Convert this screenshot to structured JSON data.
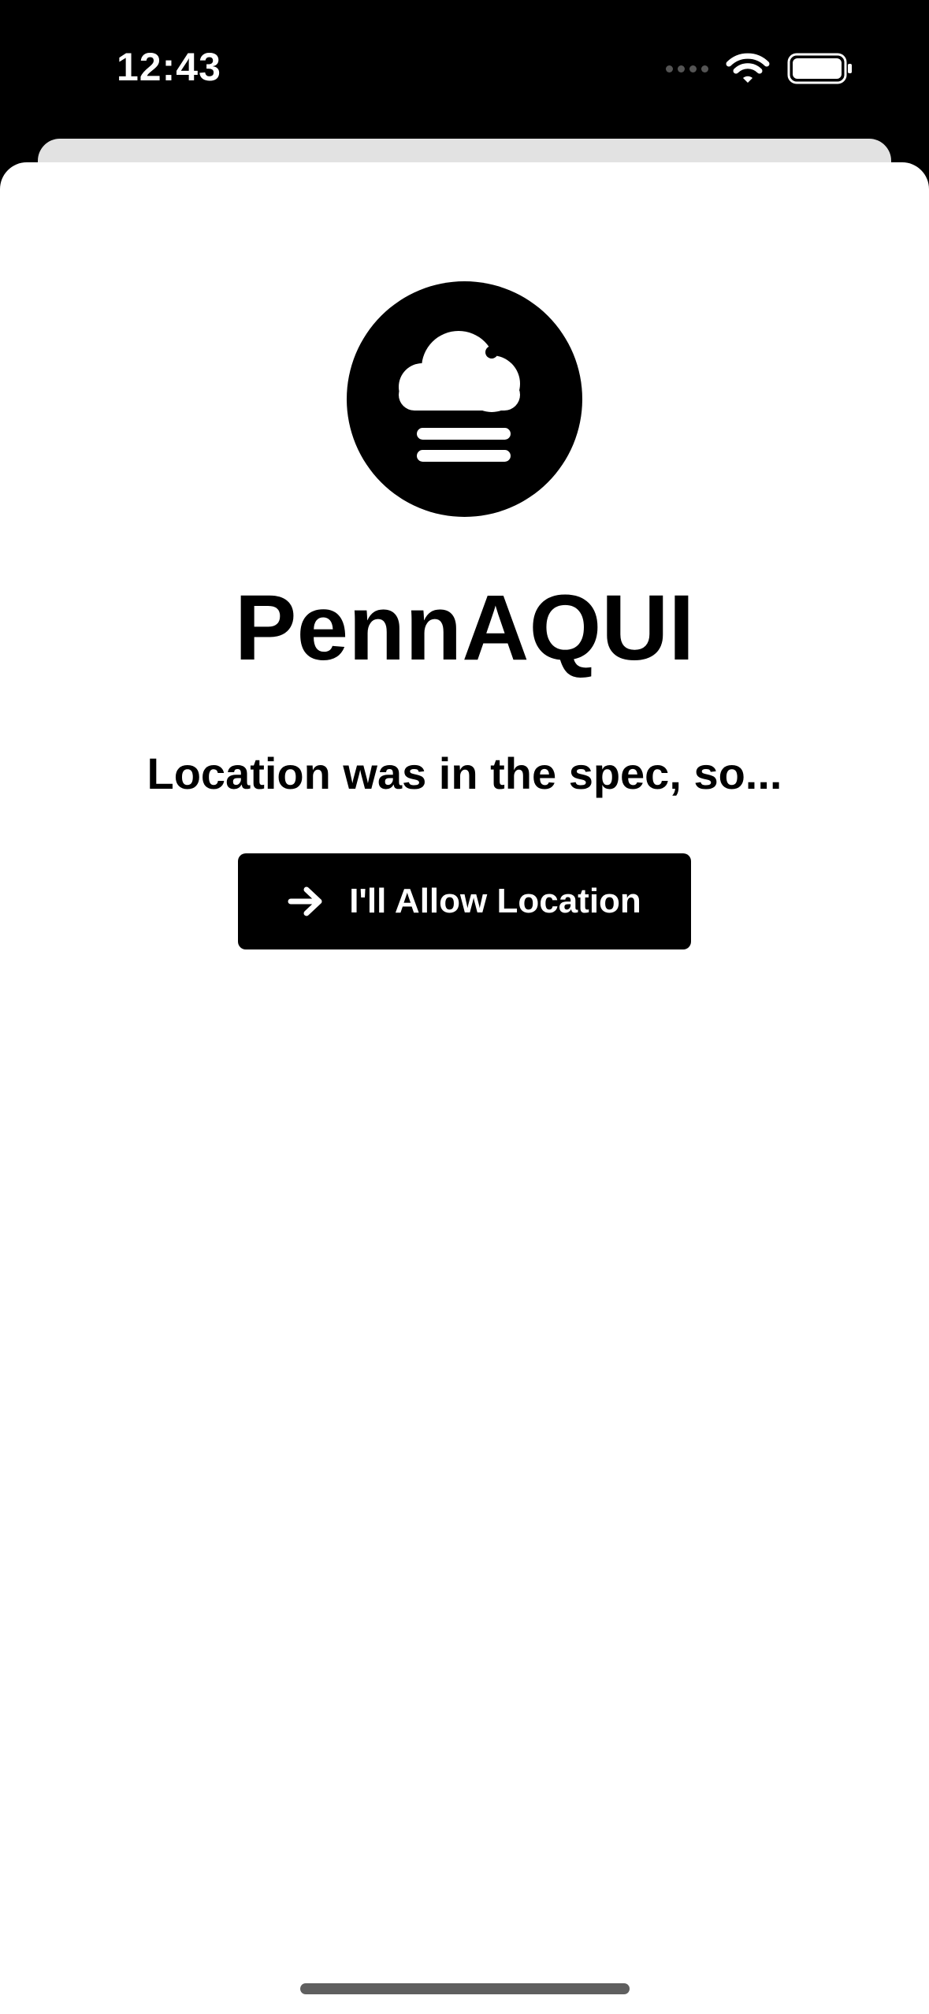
{
  "status_bar": {
    "time": "12:43",
    "icons": [
      "cellular-signal-icon",
      "wifi-icon",
      "battery-icon"
    ]
  },
  "app": {
    "logo_icon": "fog-cloud-icon",
    "title": "PennAQUI",
    "subtitle": "Location was in the spec, so..."
  },
  "allow_button": {
    "icon": "arrow-right-icon",
    "label": "I'll Allow Location"
  },
  "colors": {
    "background": "#000000",
    "sheet": "#ffffff",
    "back_sheet": "#e2e2e2",
    "button": "#000000",
    "button_text": "#ffffff",
    "home_indicator": "#5f5f5f"
  }
}
